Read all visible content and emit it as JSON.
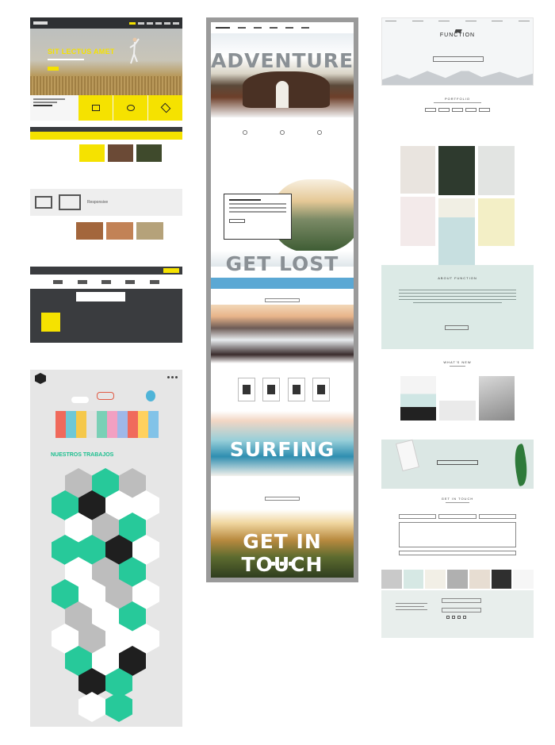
{
  "column1": {
    "hero_title": "SIT LECTUS AMET",
    "responsive_label": "Responsive",
    "section_heading": "NUESTROS TRABAJOS"
  },
  "column2": {
    "adventure": "ADVENTURE",
    "get_lost": "GET LOST",
    "surfing": "SURFING",
    "get_in_touch": "GET IN TOUCH"
  },
  "column3": {
    "logo": "FUNCTION",
    "portfolio": "PORTFOLIO",
    "about": "ABOUT FUNCTION",
    "whats_new": "WHAT'S NEW",
    "get_in_touch": "GET IN TOUCH"
  },
  "colors": {
    "yellow": "#f5e200",
    "green": "#27c99a",
    "mint": "#dceae6"
  }
}
